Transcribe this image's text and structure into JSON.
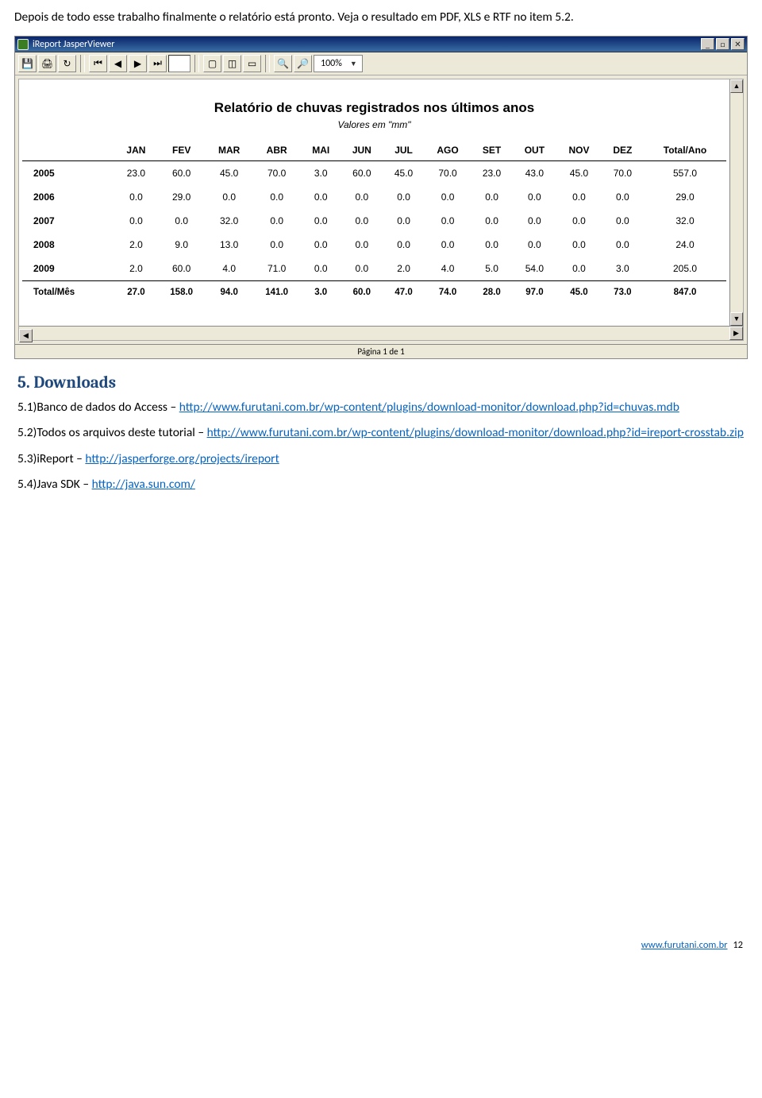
{
  "intro": "Depois de todo esse trabalho finalmente o relatório está pronto. Veja o resultado em PDF, XLS e RTF no item 5.2.",
  "window": {
    "title": "iReport JasperViewer",
    "minimize": "min",
    "maximize": "max",
    "close": "x"
  },
  "toolbar": {
    "zoom": "100%",
    "icons": {
      "save": "save-icon",
      "print": "print-icon",
      "reload": "reload-icon",
      "first": "first-page-icon",
      "prev": "prev-page-icon",
      "next": "next-page-icon",
      "last": "last-page-icon",
      "actual": "actual-icon",
      "fitpage": "fit-page-icon",
      "fitwidth": "fit-width-icon",
      "zoomin": "zoom-in-icon",
      "zoomout": "zoom-out-icon"
    }
  },
  "report": {
    "title": "Relatório de chuvas registrados nos últimos anos",
    "subtitle": "Valores em \"mm\"",
    "columns": [
      "",
      "JAN",
      "FEV",
      "MAR",
      "ABR",
      "MAI",
      "JUN",
      "JUL",
      "AGO",
      "SET",
      "OUT",
      "NOV",
      "DEZ",
      "Total/Ano"
    ],
    "rows": [
      {
        "y": "2005",
        "v": [
          "23.0",
          "60.0",
          "45.0",
          "70.0",
          "3.0",
          "60.0",
          "45.0",
          "70.0",
          "23.0",
          "43.0",
          "45.0",
          "70.0",
          "557.0"
        ]
      },
      {
        "y": "2006",
        "v": [
          "0.0",
          "29.0",
          "0.0",
          "0.0",
          "0.0",
          "0.0",
          "0.0",
          "0.0",
          "0.0",
          "0.0",
          "0.0",
          "0.0",
          "29.0"
        ]
      },
      {
        "y": "2007",
        "v": [
          "0.0",
          "0.0",
          "32.0",
          "0.0",
          "0.0",
          "0.0",
          "0.0",
          "0.0",
          "0.0",
          "0.0",
          "0.0",
          "0.0",
          "32.0"
        ]
      },
      {
        "y": "2008",
        "v": [
          "2.0",
          "9.0",
          "13.0",
          "0.0",
          "0.0",
          "0.0",
          "0.0",
          "0.0",
          "0.0",
          "0.0",
          "0.0",
          "0.0",
          "24.0"
        ]
      },
      {
        "y": "2009",
        "v": [
          "2.0",
          "60.0",
          "4.0",
          "71.0",
          "0.0",
          "0.0",
          "2.0",
          "4.0",
          "5.0",
          "54.0",
          "0.0",
          "3.0",
          "205.0"
        ]
      }
    ],
    "total_label": "Total/Mês",
    "totals": [
      "27.0",
      "158.0",
      "94.0",
      "141.0",
      "3.0",
      "60.0",
      "47.0",
      "74.0",
      "28.0",
      "97.0",
      "45.0",
      "73.0",
      "847.0"
    ]
  },
  "statusbar": "Página 1 de 1",
  "downloads": {
    "heading": "5.  Downloads",
    "items": [
      {
        "pre": "5.1)Banco de dados do Access – ",
        "url": "http://www.furutani.com.br/wp-content/plugins/download-monitor/download.php?id=chuvas.mdb"
      },
      {
        "pre": "5.2)Todos os arquivos deste tutorial – ",
        "url": "http://www.furutani.com.br/wp-content/plugins/download-monitor/download.php?id=ireport-crosstab.zip"
      },
      {
        "pre": "5.3)iReport – ",
        "url": "http://jasperforge.org/projects/ireport"
      },
      {
        "pre": "5.4)Java SDK – ",
        "url": "http://java.sun.com/"
      }
    ]
  },
  "footer": {
    "site": "www.furutani.com.br",
    "page": "12"
  }
}
